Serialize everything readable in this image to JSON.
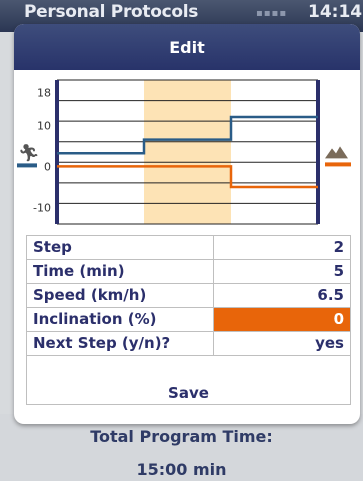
{
  "app": {
    "title": "Personal Protocols",
    "time": "14:14"
  },
  "dialog": {
    "title": "Edit",
    "save_label": "Save"
  },
  "chart_data": {
    "type": "line",
    "y_ticks": [
      "18",
      "10",
      "0",
      "-10"
    ],
    "ylim": [
      -14,
      21
    ],
    "xlim": [
      0,
      3
    ],
    "highlight_step": 2,
    "icons": {
      "left": "runner-icon",
      "right": "mountain-icon"
    },
    "series": [
      {
        "color": "#2a5c87",
        "values": [
          3.2,
          6.5,
          12.0
        ]
      },
      {
        "color": "#e8650a",
        "values": [
          0,
          0,
          -5.0
        ]
      }
    ]
  },
  "fields": [
    {
      "label": "Step",
      "value": "2",
      "highlight": false
    },
    {
      "label": "Time (min)",
      "value": "5",
      "highlight": false
    },
    {
      "label": "Speed (km/h)",
      "value": "6.5",
      "highlight": false
    },
    {
      "label": "Inclination (%)",
      "value": "0",
      "highlight": true
    },
    {
      "label": "Next Step (y/n)?",
      "value": "yes",
      "highlight": false
    }
  ],
  "footer": {
    "label": "Total Program Time:",
    "value": "15:00 min"
  }
}
